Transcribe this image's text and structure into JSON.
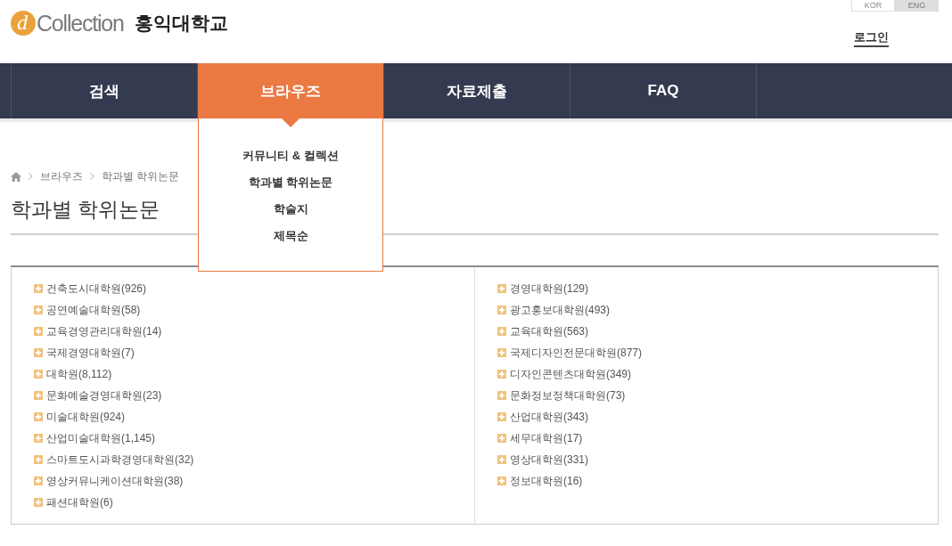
{
  "header": {
    "logo_mark": "d",
    "logo_text": "Collection",
    "university": "홍익대학교",
    "languages": [
      {
        "label": "KOR",
        "selected": false
      },
      {
        "label": "ENG",
        "selected": true
      }
    ],
    "login": "로그인"
  },
  "nav": {
    "items": [
      {
        "label": "검색",
        "selected": false
      },
      {
        "label": "브라우즈",
        "selected": true,
        "submenu": [
          "커뮤니티 & 컬렉션",
          "학과별 학위논문",
          "학술지",
          "제목순"
        ]
      },
      {
        "label": "자료제출",
        "selected": false
      },
      {
        "label": "FAQ",
        "selected": false
      }
    ]
  },
  "breadcrumb": [
    "브라우즈",
    "학과별 학위논문"
  ],
  "page_title": "학과별 학위논문",
  "columns": [
    [
      "건축도시대학원(926)",
      "공연예술대학원(58)",
      "교육경영관리대학원(14)",
      "국제경영대학원(7)",
      "대학원(8,112)",
      "문화예술경영대학원(23)",
      "미술대학원(924)",
      "산업미술대학원(1,145)",
      "스마트도시과학경영대학원(32)",
      "영상커뮤니케이션대학원(38)",
      "패션대학원(6)"
    ],
    [
      "경영대학원(129)",
      "광고홍보대학원(493)",
      "교육대학원(563)",
      "국제디자인전문대학원(877)",
      "디자인콘텐츠대학원(349)",
      "문화정보정책대학원(73)",
      "산업대학원(343)",
      "세무대학원(17)",
      "영상대학원(331)",
      "정보대학원(16)"
    ]
  ]
}
